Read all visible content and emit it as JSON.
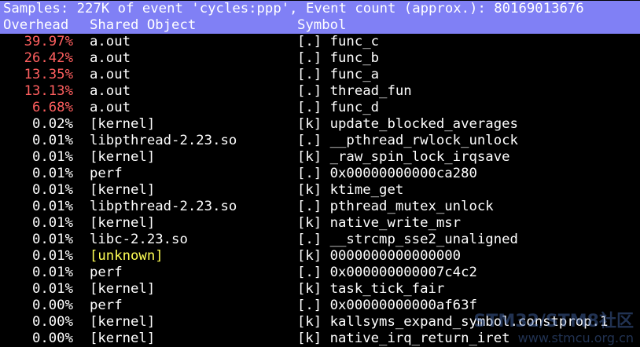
{
  "header": {
    "summary": "Samples: 227K of event 'cycles:ppp', Event count (approx.): 80169013676",
    "columns": {
      "overhead": "Overhead",
      "shared_object": "Shared Object",
      "symbol": "Symbol"
    }
  },
  "rows": [
    {
      "overhead": "39.97%",
      "shared_object": "a.out",
      "symbol": "[.] func_c"
    },
    {
      "overhead": "26.42%",
      "shared_object": "a.out",
      "symbol": "[.] func_b"
    },
    {
      "overhead": "13.35%",
      "shared_object": "a.out",
      "symbol": "[.] func_a"
    },
    {
      "overhead": "13.13%",
      "shared_object": "a.out",
      "symbol": "[.] thread_fun"
    },
    {
      "overhead": "6.68%",
      "shared_object": "a.out",
      "symbol": "[.] func_d"
    },
    {
      "overhead": "0.02%",
      "shared_object": "[kernel]",
      "symbol": "[k] update_blocked_averages"
    },
    {
      "overhead": "0.01%",
      "shared_object": "libpthread-2.23.so",
      "symbol": "[.] __pthread_rwlock_unlock"
    },
    {
      "overhead": "0.01%",
      "shared_object": "[kernel]",
      "symbol": "[k] _raw_spin_lock_irqsave"
    },
    {
      "overhead": "0.01%",
      "shared_object": "perf",
      "symbol": "[.] 0x00000000000ca280"
    },
    {
      "overhead": "0.01%",
      "shared_object": "[kernel]",
      "symbol": "[k] ktime_get"
    },
    {
      "overhead": "0.01%",
      "shared_object": "libpthread-2.23.so",
      "symbol": "[.] pthread_mutex_unlock"
    },
    {
      "overhead": "0.01%",
      "shared_object": "[kernel]",
      "symbol": "[k] native_write_msr"
    },
    {
      "overhead": "0.01%",
      "shared_object": "libc-2.23.so",
      "symbol": "[.] __strcmp_sse2_unaligned"
    },
    {
      "overhead": "0.01%",
      "shared_object": "[unknown]",
      "symbol": "[k] 0000000000000000"
    },
    {
      "overhead": "0.01%",
      "shared_object": "perf",
      "symbol": "[.] 0x000000000007c4c2"
    },
    {
      "overhead": "0.01%",
      "shared_object": "[kernel]",
      "symbol": "[k] task_tick_fair"
    },
    {
      "overhead": "0.00%",
      "shared_object": "perf",
      "symbol": "[.] 0x00000000000af63f"
    },
    {
      "overhead": "0.00%",
      "shared_object": "[kernel]",
      "symbol": "[k] kallsyms_expand_symbol.constprop.1"
    },
    {
      "overhead": "0.00%",
      "shared_object": "[kernel]",
      "symbol": "[k] native_irq_return_iret"
    }
  ],
  "watermark": {
    "main": "STM32/STM8社区",
    "sub": "www.stmcu.org.cn"
  },
  "colors": {
    "header_bg": "#8080f5",
    "background": "#000000",
    "text": "#ffffff",
    "hot_overhead": "#ff5f5f",
    "unknown_object": "#ffff55"
  }
}
